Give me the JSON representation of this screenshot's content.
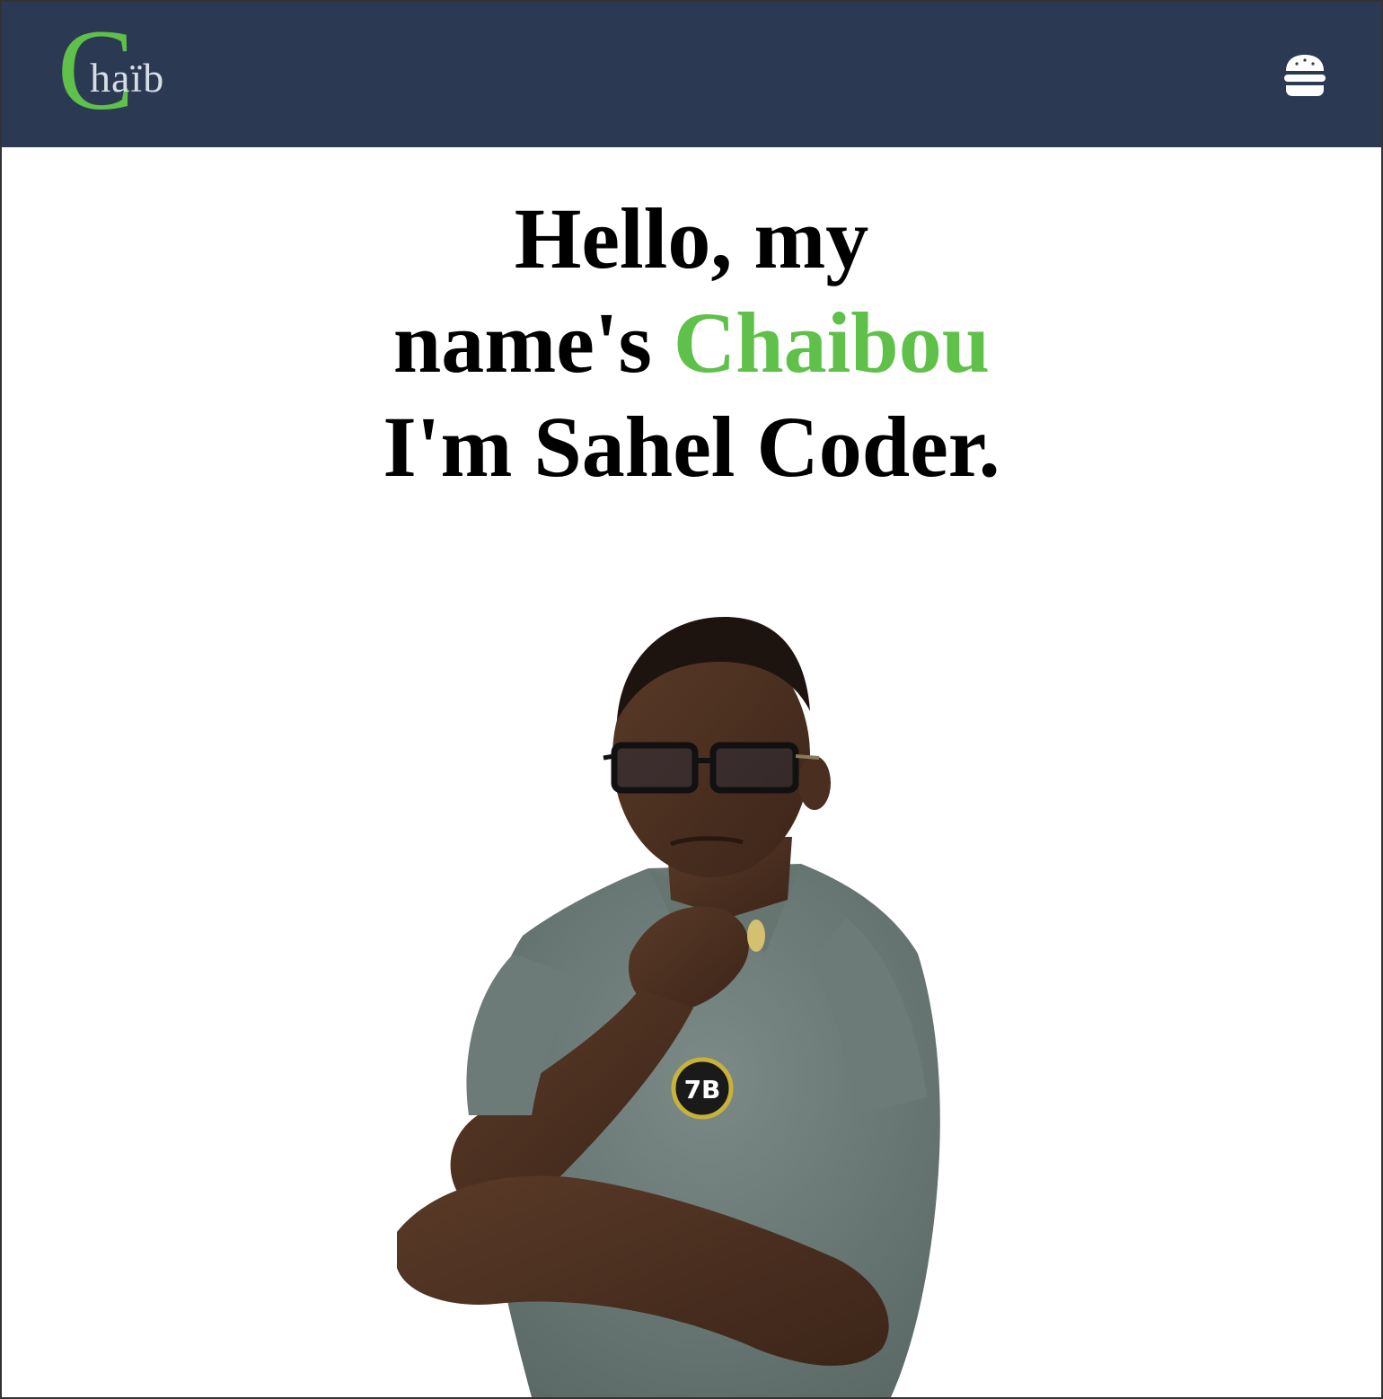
{
  "navbar": {
    "logo": {
      "initial": "C",
      "rest": "haïb"
    },
    "menu_icon": "burger-menu-icon"
  },
  "hero": {
    "line1": "Hello, my",
    "line2_prefix": "name's ",
    "line2_name": "Chaibou",
    "line3": "I'm Sahel Coder."
  },
  "portrait": {
    "badge_text": "7B"
  },
  "colors": {
    "navbar_bg": "#2b3a52",
    "accent": "#5fc04a",
    "text": "#000000",
    "logo_text": "#d7dde5"
  }
}
